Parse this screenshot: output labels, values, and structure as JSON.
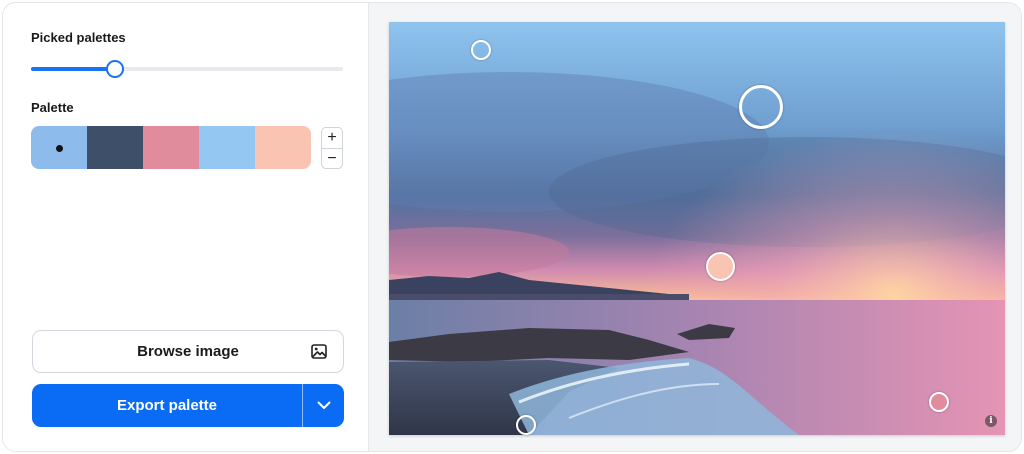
{
  "controls": {
    "picked_palettes_label": "Picked palettes",
    "slider_value_fraction": 0.27,
    "palette_label": "Palette",
    "stepper_plus": "+",
    "stepper_minus": "−"
  },
  "palette": {
    "swatches": [
      {
        "color": "#8dbcec",
        "selected": true
      },
      {
        "color": "#3e5069",
        "selected": false
      },
      {
        "color": "#e18c9c",
        "selected": false
      },
      {
        "color": "#94c8f3",
        "selected": false
      },
      {
        "color": "#f9c4b2",
        "selected": false
      }
    ]
  },
  "buttons": {
    "browse_label": "Browse image",
    "export_label": "Export palette"
  },
  "image": {
    "info_glyph": "i",
    "pickers": [
      {
        "color": "#8dbcec"
      },
      {
        "color": "#3e5069"
      },
      {
        "color": "#f9c4b2"
      },
      {
        "color": "#3e5069"
      },
      {
        "color": "#e18c9c"
      }
    ]
  },
  "theme": {
    "accent": "#0a6cf5",
    "slider_accent": "#1a73f2"
  }
}
